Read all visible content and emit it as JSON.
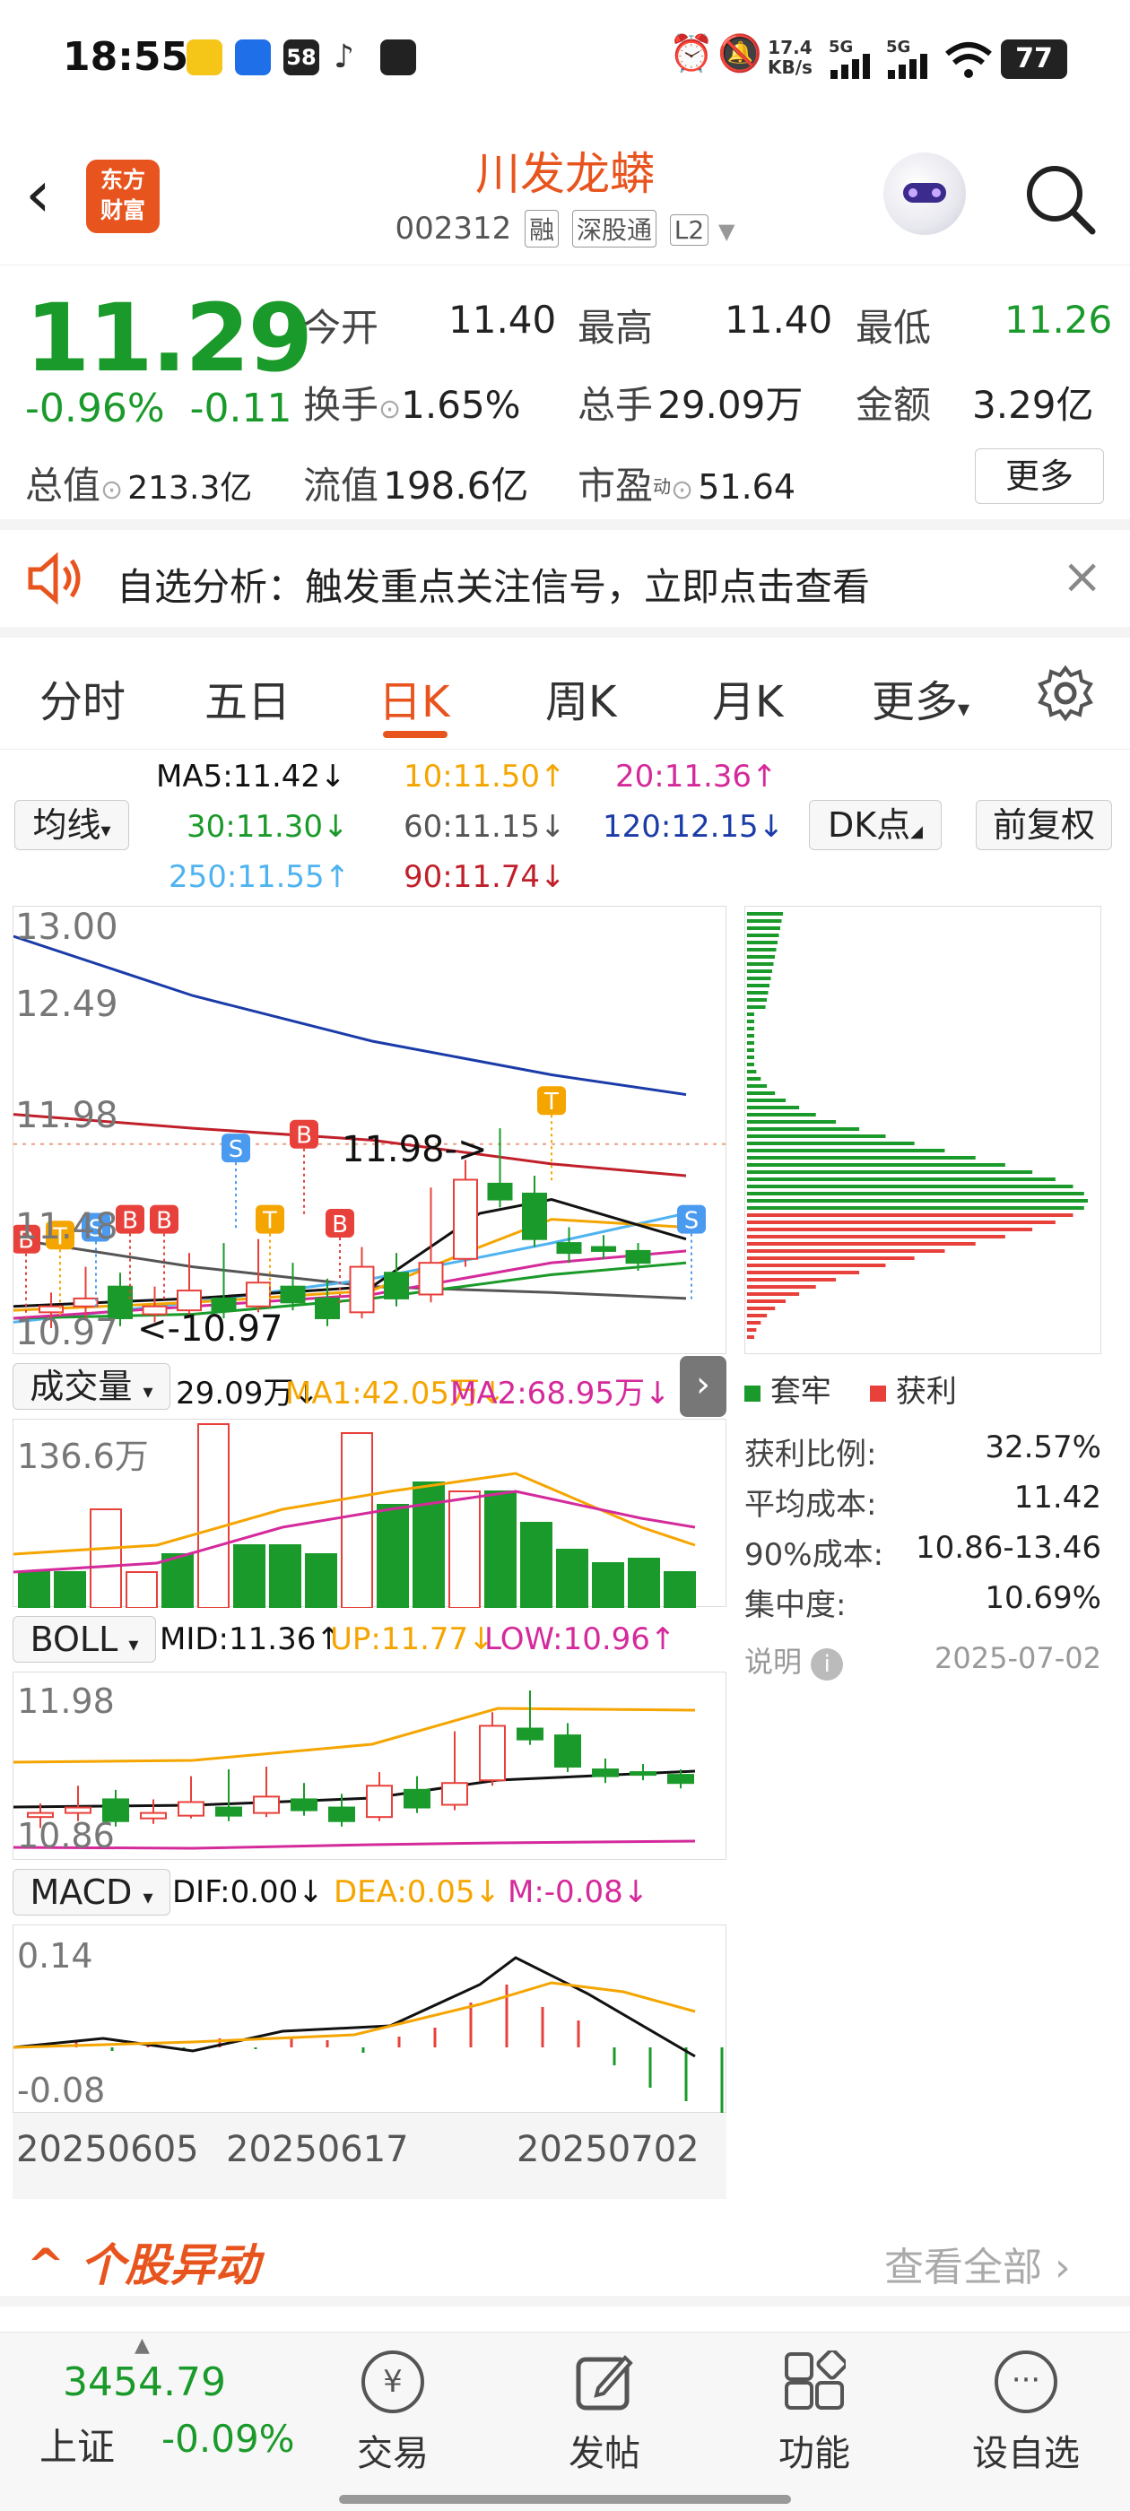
{
  "status_bar": {
    "time": "18:55",
    "net_speed_top": "17.4",
    "net_speed_bottom": "KB/s",
    "signal_1": "5G",
    "signal_2": "5G",
    "battery": "77",
    "app_badge": "58"
  },
  "header": {
    "logo_line1": "东方",
    "logo_line2": "财富",
    "stock_name": "川发龙蟒",
    "stock_code": "002312",
    "tags": [
      "融",
      "深股通",
      "L2"
    ]
  },
  "quote": {
    "price": "11.29",
    "change_pct": "-0.96%",
    "change_abs": "-0.11",
    "total_value_label": "总值",
    "total_value": "213.3亿",
    "open_label": "今开",
    "open": "11.40",
    "high_label": "最高",
    "high": "11.40",
    "low_label": "最低",
    "low": "11.26",
    "turnover_label": "换手",
    "turnover": "1.65%",
    "volume_label": "总手",
    "volume": "29.09万",
    "amount_label": "金额",
    "amount": "3.29亿",
    "float_label": "流值",
    "float_value": "198.6亿",
    "pe_label": "市盈",
    "pe_sup": "动",
    "pe": "51.64",
    "more_label": "更多"
  },
  "banner": {
    "text": "自选分析：触发重点关注信号，立即点击查看"
  },
  "tabs": [
    "分时",
    "五日",
    "日K",
    "周K",
    "月K",
    "更多"
  ],
  "active_tab": 2,
  "ma_panel": {
    "selector_label": "均线",
    "dk_label": "DK点",
    "adjust_label": "前复权",
    "ma5": "MA5:11.42",
    "ma10": "10:11.50",
    "ma20": "20:11.36",
    "ma30": "30:11.30",
    "ma60": "60:11.15",
    "ma120": "120:12.15",
    "ma250": "250:11.55",
    "ma90": "90:11.74"
  },
  "kline": {
    "y_labels": [
      "13.00",
      "12.49",
      "11.98",
      "11.48",
      "10.97"
    ],
    "high_marker": "11.98->",
    "low_marker": "<-10.97",
    "signal_labels": [
      "B",
      "T",
      "S",
      "B",
      "B",
      "S",
      "T",
      "B",
      "B",
      "T",
      "S",
      "S"
    ],
    "colors": {
      "up": "#e8403a",
      "down": "#1a9a2a",
      "ma5": "#111111",
      "ma10": "#f5a500",
      "ma20": "#d42a9b",
      "ma30": "#1a9a2a",
      "ma60": "#555555",
      "ma120": "#1a3ba8",
      "ma250": "#4fb3f0",
      "ma90": "#c0202a"
    }
  },
  "chips": {
    "legend_hold": "套牢",
    "legend_profit": "获利",
    "rows": [
      {
        "label": "获利比例:",
        "value": "32.57%"
      },
      {
        "label": "平均成本:",
        "value": "11.42"
      },
      {
        "label": "90%成本:",
        "value": "10.86-13.46"
      },
      {
        "label": "集中度:",
        "value": "10.69%"
      }
    ],
    "note_label": "说明",
    "date": "2025-07-02"
  },
  "volume_panel": {
    "selector_label": "成交量",
    "vol": "29.09万",
    "ma1": "MA1:42.05万",
    "ma2": "MA2:68.95万",
    "y_top": "136.6万"
  },
  "boll_panel": {
    "selector_label": "BOLL",
    "mid": "MID:11.36",
    "up": "UP:11.77",
    "low": "LOW:10.96",
    "y_top": "11.98",
    "y_bottom": "10.86"
  },
  "macd_panel": {
    "selector_label": "MACD",
    "dif": "DIF:0.00",
    "dea": "DEA:0.05",
    "m": "M:-0.08",
    "y_top": "0.14",
    "y_bottom": "-0.08"
  },
  "x_dates": [
    "20250605",
    "20250617",
    "20250702"
  ],
  "movers": {
    "title": "个股异动",
    "view_all": "查看全部"
  },
  "bottom_nav": {
    "index_value": "3454.79",
    "index_name": "上证",
    "index_change": "-0.09%",
    "items": [
      "交易",
      "发帖",
      "功能",
      "设自选"
    ]
  }
}
